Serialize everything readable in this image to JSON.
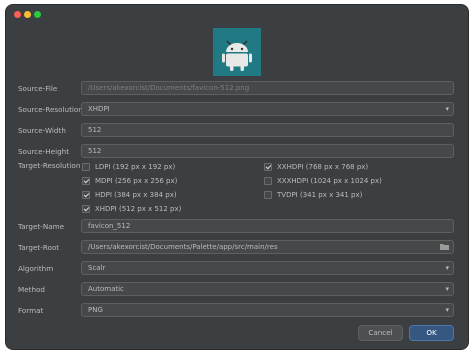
{
  "window": {
    "controls": [
      "close",
      "minimize",
      "zoom"
    ]
  },
  "preview": {
    "icon": "android-robot-icon",
    "background": "#1f7a84"
  },
  "form": {
    "source_file": {
      "label": "Source-File",
      "placeholder": "/Users/akexorcist/Documents/favicon-512.png"
    },
    "source_resolution": {
      "label": "Source-Resolution",
      "value": "XHDPI"
    },
    "source_width": {
      "label": "Source-Width",
      "value": "512"
    },
    "source_height": {
      "label": "Source-Height",
      "value": "512"
    },
    "target_resolution": {
      "label": "Target-Resolution",
      "options": [
        {
          "label": "LDPI (192 px x 192 px)",
          "checked": false
        },
        {
          "label": "XXHDPI (768 px x 768 px)",
          "checked": true
        },
        {
          "label": "MDPI (256 px x 256 px)",
          "checked": true
        },
        {
          "label": "XXXHDPI (1024 px x 1024 px)",
          "checked": false
        },
        {
          "label": "HDPI (384 px x 384 px)",
          "checked": true
        },
        {
          "label": "TVDPI (341 px x 341 px)",
          "checked": false
        },
        {
          "label": "XHDPI (512 px x 512 px)",
          "checked": true
        }
      ]
    },
    "target_name": {
      "label": "Target-Name",
      "value": "favicon_512"
    },
    "target_root": {
      "label": "Target-Root",
      "value": "/Users/akexorcist/Documents/Palette/app/src/main/res"
    },
    "algorithm": {
      "label": "Algorithm",
      "value": "Scalr"
    },
    "method": {
      "label": "Method",
      "value": "Automatic"
    },
    "format": {
      "label": "Format",
      "value": "PNG"
    }
  },
  "buttons": {
    "cancel": "Cancel",
    "ok": "OK"
  },
  "colors": {
    "background": "#3c3f41",
    "field": "#45494a",
    "accent": "#365880"
  }
}
